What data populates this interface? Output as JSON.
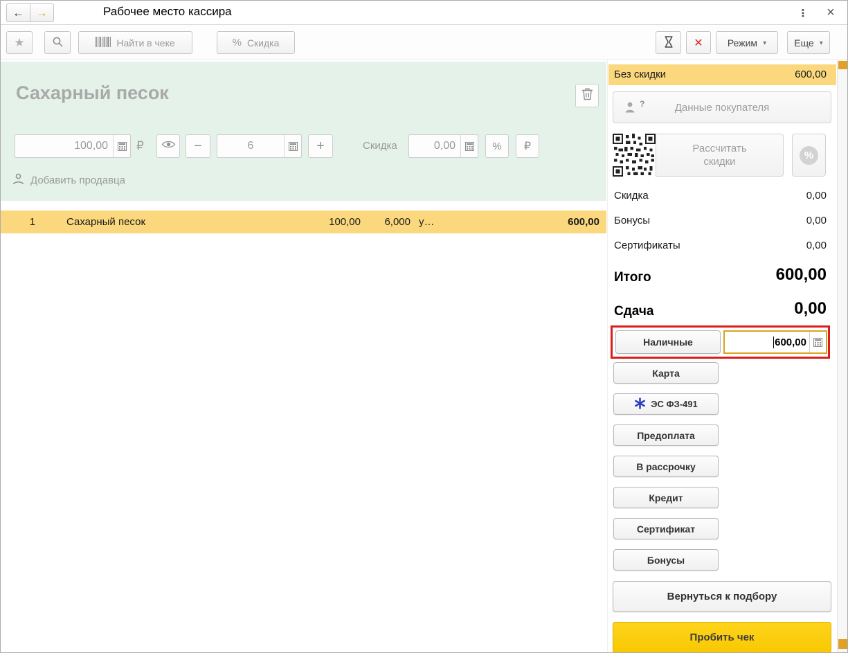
{
  "window": {
    "title": "Рабочее место кассира"
  },
  "icons": {
    "back": "←",
    "forward": "→",
    "kebab": "⋮",
    "close": "×",
    "star": "★",
    "percent": "%",
    "ruble": "₽",
    "minus": "−",
    "plus": "+",
    "caret": "▾",
    "cancel_x": "✕",
    "question": "?"
  },
  "toolbar": {
    "find_in_receipt_label": "Найти в чеке",
    "discount_label": "Скидка",
    "mode_label": "Режим",
    "more_label": "Еще"
  },
  "product_panel": {
    "title": "Сахарный песок",
    "price": "100,00",
    "currency": "₽",
    "quantity": "6",
    "discount_label": "Скидка",
    "discount_value": "0,00",
    "add_seller_label": "Добавить продавца"
  },
  "receipt": {
    "row": {
      "num": "1",
      "name": "Сахарный песок",
      "price": "100,00",
      "qty": "6,000",
      "unit": "у…",
      "sum": "600,00"
    }
  },
  "summary": {
    "no_discount_label": "Без скидки",
    "no_discount_value": "600,00",
    "customer_button_label": "Данные покупателя",
    "calc_discounts_label": "Рассчитать скидки",
    "discount_label": "Скидка",
    "discount_value": "0,00",
    "bonuses_label": "Бонусы",
    "bonuses_value": "0,00",
    "certificates_label": "Сертификаты",
    "certificates_value": "0,00",
    "total_label": "Итого",
    "total_value": "600,00",
    "change_label": "Сдача",
    "change_value": "0,00"
  },
  "payment": {
    "cash_label": "Наличные",
    "cash_amount": "600,00",
    "card_label": "Карта",
    "es_label": "ЭС ФЗ-491",
    "prepayment_label": "Предоплата",
    "installment_label": "В рассрочку",
    "credit_label": "Кредит",
    "certificate_label": "Сертификат",
    "bonuses_label": "Бонусы",
    "back_to_selection_label": "Вернуться к подбору",
    "print_receipt_label": "Пробить чек"
  },
  "colors": {
    "highlight_yellow": "#fbd87d",
    "action_yellow": "#fccf0b",
    "attention_red": "#dd1c1c",
    "field_gold_border": "#d8a21b",
    "panel_mint": "#e4f2ea"
  }
}
